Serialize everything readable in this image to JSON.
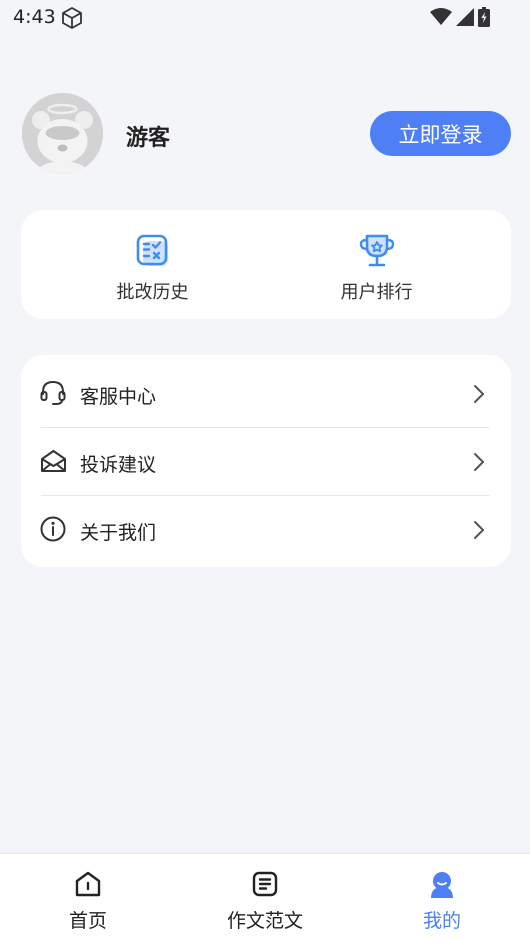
{
  "status_bar": {
    "time": "4:43"
  },
  "profile": {
    "username": "游客",
    "login_label": "立即登录"
  },
  "quick_actions": [
    {
      "label": "批改历史",
      "icon": "grading-history-icon"
    },
    {
      "label": "用户排行",
      "icon": "trophy-icon"
    }
  ],
  "menu": [
    {
      "label": "客服中心",
      "icon": "headset-icon"
    },
    {
      "label": "投诉建议",
      "icon": "mail-icon"
    },
    {
      "label": "关于我们",
      "icon": "info-icon"
    }
  ],
  "bottom_nav": [
    {
      "label": "首页",
      "icon": "home-icon",
      "active": false
    },
    {
      "label": "作文范文",
      "icon": "document-icon",
      "active": false
    },
    {
      "label": "我的",
      "icon": "profile-icon",
      "active": true
    }
  ],
  "colors": {
    "accent": "#4e7ff5",
    "background": "#f4f5f8",
    "card": "#ffffff"
  }
}
